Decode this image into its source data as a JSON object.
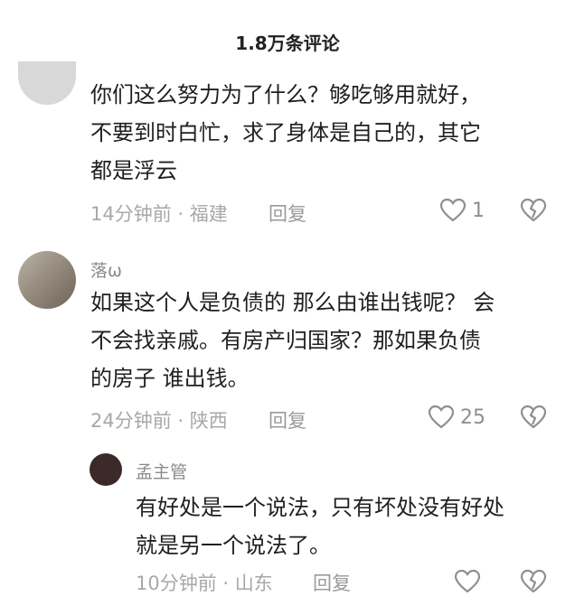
{
  "header": {
    "title": "1.8万条评论"
  },
  "comments": [
    {
      "avatar": "gray-avatar",
      "lines": [
        "你们这么努力为了什么？够吃够用就好，",
        "不要到时白忙，求了身体是自己的，其它",
        "都是浮云"
      ],
      "time_location": "14分钟前 · 福建",
      "reply_label": "回复",
      "likes": "1",
      "icons": {
        "like": "heart-icon",
        "dislike": "broken-heart-icon"
      }
    },
    {
      "username": "落ω",
      "avatar": "photo-avatar",
      "lines": [
        "如果这个人是负债的 那么由谁出钱呢？ 会",
        "不会找亲戚。有房产归国家？那如果负债",
        "的房子 谁出钱。"
      ],
      "time_location": "24分钟前 · 陕西",
      "reply_label": "回复",
      "likes": "25",
      "icons": {
        "like": "heart-icon",
        "dislike": "broken-heart-icon"
      }
    },
    {
      "username": "孟主管",
      "avatar": "small-avatar",
      "lines": [
        "有好处是一个说法，只有坏处没有好处",
        "就是另一个说法了。"
      ],
      "time_location": "10分钟前 · 山东",
      "reply_label": "回复",
      "icons": {
        "like": "heart-icon",
        "dislike": "broken-heart-icon"
      }
    }
  ]
}
